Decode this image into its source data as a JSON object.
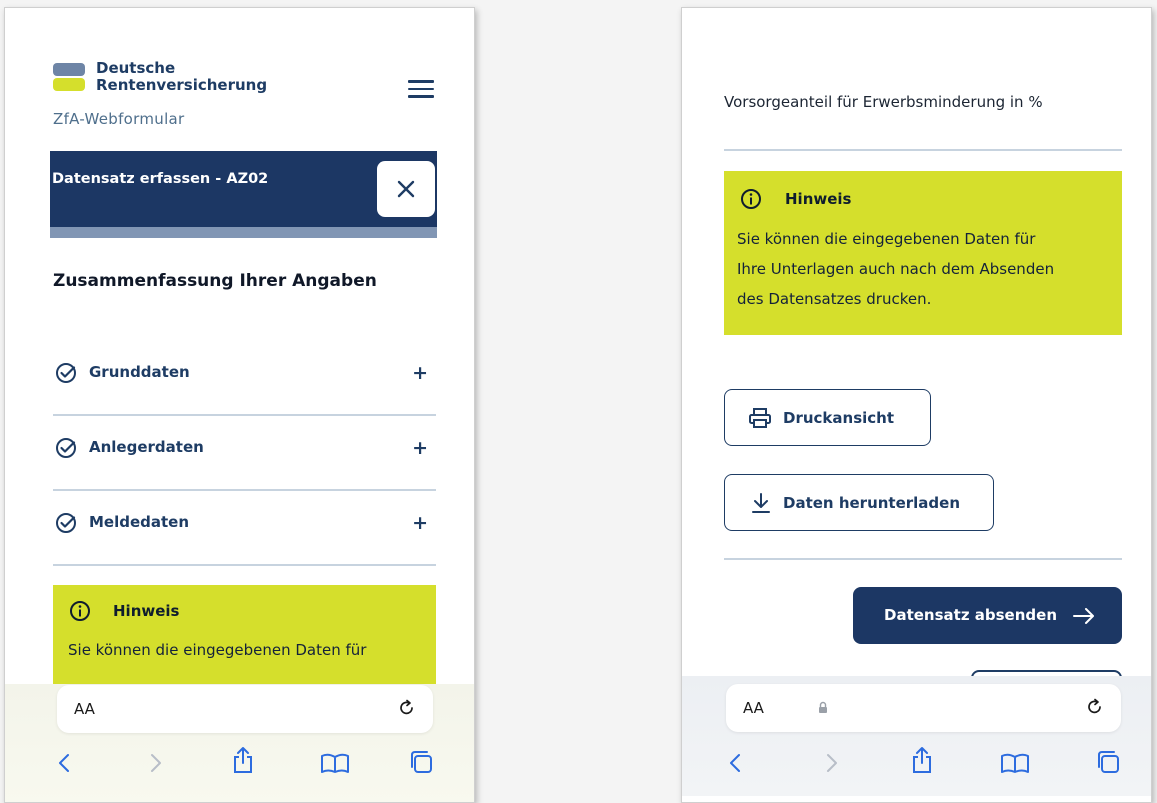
{
  "left": {
    "brand": {
      "line1": "Deutsche",
      "line2": "Rentenversicherung",
      "colors": {
        "blue": "#6e85a6",
        "yellow": "#d5df2c",
        "text": "#1e3c64"
      }
    },
    "app_subtitle": "ZfA-Webformular",
    "banner": {
      "title": "Datensatz erfassen - AZ02",
      "bg": "#1c3764"
    },
    "summary_heading": "Zusammenfassung Ihrer Angaben",
    "accordion": [
      {
        "label": "Grunddaten",
        "expand": "+"
      },
      {
        "label": "Anlegerdaten",
        "expand": "+"
      },
      {
        "label": "Meldedaten",
        "expand": "+"
      }
    ],
    "hint": {
      "title": "Hinweis",
      "text": "Sie können die eingegebenen Daten für",
      "bg": "#d5df2c"
    },
    "browser": {
      "text_size_label": "AA"
    }
  },
  "right": {
    "field_label": "Vorsorgeanteil für Erwerbsminderung in %",
    "hint": {
      "title": "Hinweis",
      "lines": [
        "Sie können die eingegebenen Daten für",
        "Ihre Unterlagen auch nach dem Absenden",
        "des Datensatzes drucken."
      ]
    },
    "print_button": "Druckansicht",
    "download_button": "Daten herunterladen",
    "submit_button": "Datensatz absenden",
    "browser": {
      "text_size_label": "AA"
    }
  },
  "icons": {
    "menu": "hamburger-icon",
    "close": "close-icon",
    "check": "check-circle-icon",
    "info": "info-icon",
    "printer": "printer-icon",
    "download": "download-icon",
    "arrow": "arrow-right-icon",
    "lock": "lock-icon",
    "reload": "reload-icon",
    "back": "back-icon",
    "forward": "forward-icon",
    "share": "share-icon",
    "bookmarks": "bookmarks-icon",
    "tabs": "tabs-icon"
  }
}
